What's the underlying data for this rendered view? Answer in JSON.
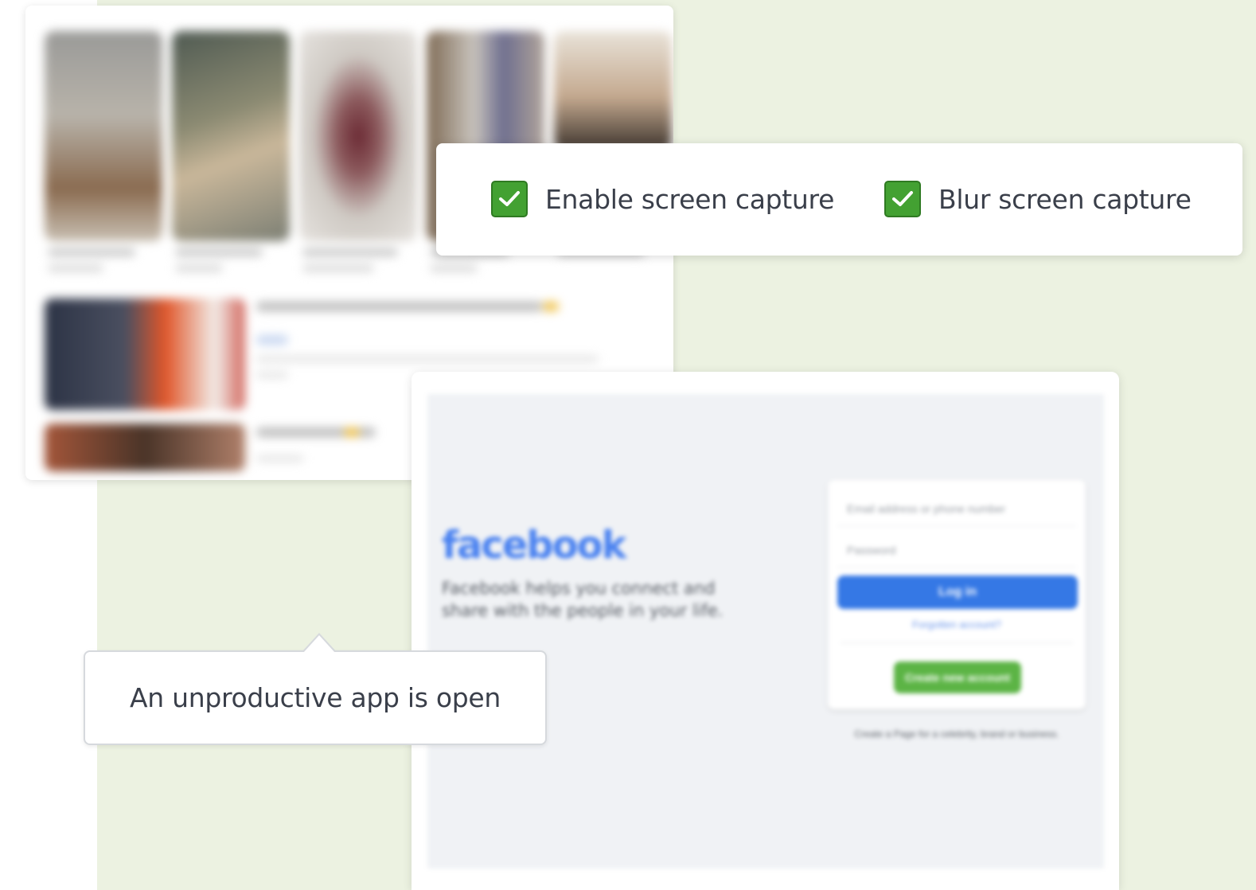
{
  "settings": {
    "enable_capture": {
      "label": "Enable screen capture",
      "checked": true,
      "icon": "checkmark-icon"
    },
    "blur_capture": {
      "label": "Blur screen capture",
      "checked": true,
      "icon": "checkmark-icon"
    },
    "checkbox_color": "#43a132"
  },
  "tooltip": {
    "text": "An unproductive app is open"
  },
  "facebook_capture": {
    "logo": "facebook",
    "tagline": "Facebook helps you connect and share with the people in your life.",
    "email_placeholder": "Email address or phone number",
    "password_placeholder": "Password",
    "login_label": "Log in",
    "forgot_label": "Forgotten account?",
    "create_label": "Create new account",
    "footer": "Create a Page for a celebrity, brand or business.",
    "brand_color": "#3578e5"
  },
  "colors": {
    "backdrop": "#ecf2e1",
    "text": "#3a3f4a"
  }
}
